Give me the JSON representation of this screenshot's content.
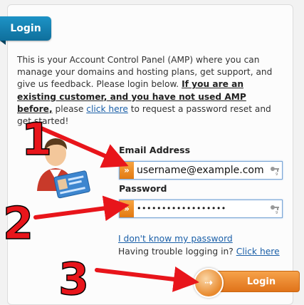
{
  "tab": {
    "label": "Login"
  },
  "intro": {
    "text1": "This is your Account Control Panel (AMP) where you can manage your domains and hosting plans, get support, and give us feedback. Please login below. ",
    "bold": "If you are an existing customer, and you have not used AMP before,",
    "text2": " please ",
    "link": "click here",
    "text3": " to request a password reset and get started!"
  },
  "email": {
    "label": "Email Address",
    "value": "username@example.com"
  },
  "password": {
    "label": "Password",
    "value": "••••••••••••••••••"
  },
  "links": {
    "forgot": "I don't know my password",
    "trouble_text": "Having trouble logging in? ",
    "trouble_link": "Click here"
  },
  "login_button": {
    "label": "Login"
  },
  "annotations": {
    "step1": "1",
    "step2": "2",
    "step3": "3"
  },
  "colors": {
    "arrow": "#e8151b",
    "accent": "#e27a12",
    "tab": "#1a84b8"
  },
  "icons": {
    "user": "user-id-card-icon",
    "field": "chevron-right-icon",
    "key": "key-icon",
    "button": "arrow-right-icon"
  }
}
